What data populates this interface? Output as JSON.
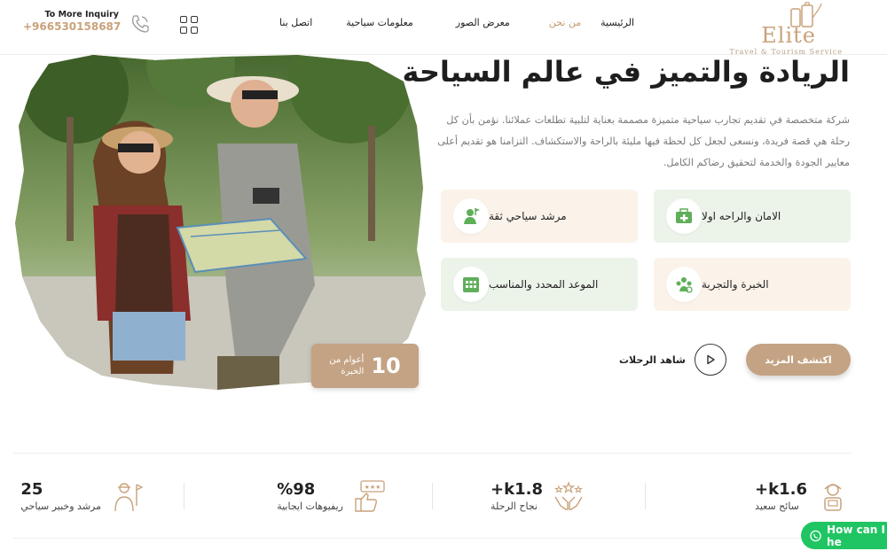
{
  "header": {
    "logo_text": "Elite",
    "logo_sub": "Travel & Tourism Service",
    "nav": [
      "الرئيسية",
      "من نحن",
      "معرض الصور",
      "معلومات سياحية",
      "اتصل بنا"
    ],
    "inquiry_label": "To More Inquiry",
    "phone": "+966530158687"
  },
  "hero": {
    "title": "الريادة والتميز في عالم السياحة",
    "description": "شركة متخصصة في تقديم تجارب سياحية متميزة مصممة بعناية لتلبية تطلعات عملائنا. نؤمن بأن كل رحلة هي قصة فريدة، ونسعى لجعل كل لحظة فيها مليئة بالراحة والاستكشاف. التزامنا هو تقديم أعلى معايير الجودة والخدمة لتحقيق رضاكم الكامل.",
    "experience_number": "10",
    "experience_text_1": "أعوام من",
    "experience_text_2": "الخبرة",
    "features": [
      {
        "label": "الامان والراحه اولا",
        "icon": "first-aid-icon"
      },
      {
        "label": "مرشد سياحي ثقة",
        "icon": "guide-icon"
      },
      {
        "label": "الخبرة والتجربة",
        "icon": "team-icon"
      },
      {
        "label": "الموعد المحدد والمناسب",
        "icon": "calendar-icon"
      }
    ],
    "explore_label": "اكتشف المزيد",
    "watch_label": "شاهد الرحلات"
  },
  "stats": [
    {
      "value": "+k1.6",
      "label": "سائح سعيد",
      "icon": "tourist-icon"
    },
    {
      "value": "+k1.8",
      "label": "نجاح الرحلة",
      "icon": "hands-stars-icon"
    },
    {
      "value": "%98",
      "label": "ريفيوهات ايجابية",
      "icon": "thumbs-up-rating-icon"
    },
    {
      "value": "25",
      "label": "مرشد وخبير سياحي",
      "icon": "guide-flag-icon"
    }
  ],
  "chat": {
    "label": "How can I he"
  },
  "colors": {
    "accent": "#c3a384",
    "green_tint": "#ecf4ea",
    "beige_tint": "#fbf3ea",
    "whatsapp": "#20c563"
  }
}
